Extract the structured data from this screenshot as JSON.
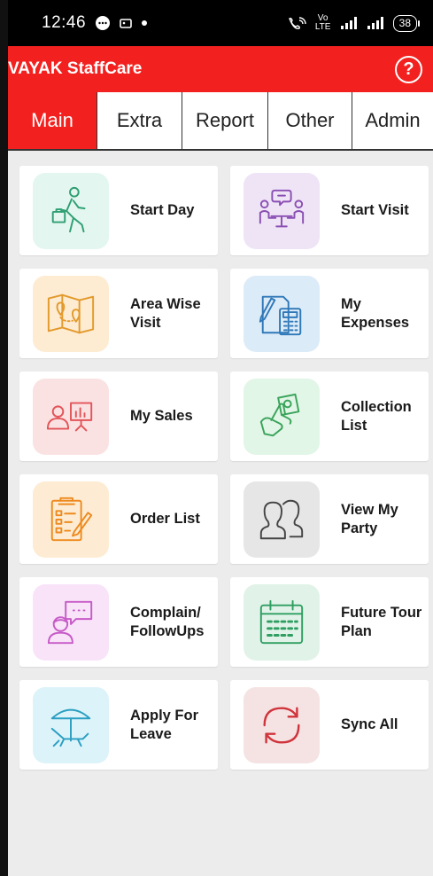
{
  "status_bar": {
    "time": "12:46",
    "network_text": "Vo LTE",
    "battery": "38"
  },
  "app_bar": {
    "title": "VAYAK StaffCare",
    "help_label": "?"
  },
  "tabs": [
    {
      "label": "Main",
      "active": true
    },
    {
      "label": "Extra",
      "active": false
    },
    {
      "label": "Report",
      "active": false
    },
    {
      "label": "Other",
      "active": false
    },
    {
      "label": "Admin",
      "active": false
    }
  ],
  "menu": [
    {
      "label": "Start Day",
      "icon": "walking-person-icon",
      "tile_color": "#e3f6ef",
      "icon_color": "#2f9f73"
    },
    {
      "label": "Start Visit",
      "icon": "meeting-icon",
      "tile_color": "#efe4f6",
      "icon_color": "#8a4fb3"
    },
    {
      "label": "Area Wise\nVisit",
      "icon": "map-icon",
      "tile_color": "#fdebd2",
      "icon_color": "#e39a2c"
    },
    {
      "label": "My\nExpenses",
      "icon": "calculator-icon",
      "tile_color": "#dcebf8",
      "icon_color": "#2f78b8"
    },
    {
      "label": "My Sales",
      "icon": "presentation-icon",
      "tile_color": "#fbe2e2",
      "icon_color": "#e2555a"
    },
    {
      "label": "Collection\nList",
      "icon": "money-hand-icon",
      "tile_color": "#e1f6e7",
      "icon_color": "#3aa35a"
    },
    {
      "label": "Order List",
      "icon": "clipboard-icon",
      "tile_color": "#fdecd3",
      "icon_color": "#ee8a1f"
    },
    {
      "label": "View My\nParty",
      "icon": "people-icon",
      "tile_color": "#e6e6e6",
      "icon_color": "#444444"
    },
    {
      "label": "Complain/\nFollowUps",
      "icon": "chat-person-icon",
      "tile_color": "#f8e3f8",
      "icon_color": "#c75ac7"
    },
    {
      "label": "Future Tour\nPlan",
      "icon": "calendar-icon",
      "tile_color": "#e1f3e8",
      "icon_color": "#2f9e61"
    },
    {
      "label": "Apply For\nLeave",
      "icon": "beach-umbrella-icon",
      "tile_color": "#dcf3f9",
      "icon_color": "#2a9fc2"
    },
    {
      "label": "Sync All",
      "icon": "sync-icon",
      "tile_color": "#f5e3e3",
      "icon_color": "#d0343c"
    }
  ]
}
